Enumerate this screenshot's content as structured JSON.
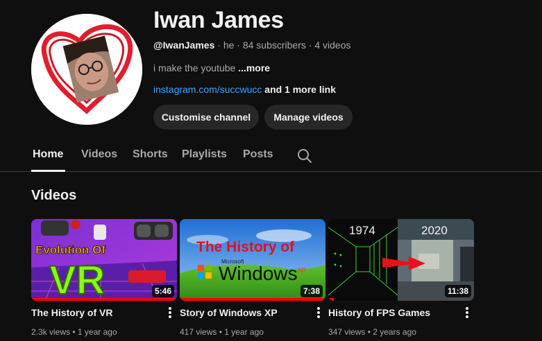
{
  "channel": {
    "name": "Iwan James",
    "handle": "@IwanJames",
    "pronoun": " · he · ",
    "subscribers": "84 subscribers",
    "separator": " · ",
    "video_count": "4 videos",
    "description": "i make the youtube ",
    "more_label": "...more",
    "link": "instagram.com/succwucc",
    "more_links": " and 1 more link"
  },
  "buttons": {
    "customise": "Customise channel",
    "manage": "Manage videos"
  },
  "tabs": [
    "Home",
    "Videos",
    "Shorts",
    "Playlists",
    "Posts"
  ],
  "active_tab": "Home",
  "section": {
    "title": "Videos"
  },
  "videos": [
    {
      "title": "The History of VR",
      "views": "2.3k views",
      "age": "1 year ago",
      "duration": "5:46",
      "progress_pct": 100,
      "thumb_text": [
        "Evolution Of",
        "VR"
      ]
    },
    {
      "title": "Story of Windows XP",
      "views": "417 views",
      "age": "1 year ago",
      "duration": "7:38",
      "progress_pct": 100,
      "thumb_text": [
        "The History of",
        "Microsoft",
        "Windows",
        "xp"
      ]
    },
    {
      "title": "History of FPS Games",
      "views": "347 views",
      "age": "2 years ago",
      "duration": "11:38",
      "progress_pct": 4,
      "thumb_text": [
        "1974",
        "2020"
      ]
    }
  ],
  "meta_separator": " • ",
  "colors": {
    "background": "#0f0f0f",
    "link": "#3ea6ff",
    "progress": "#ff0000",
    "button_bg": "#272727"
  }
}
